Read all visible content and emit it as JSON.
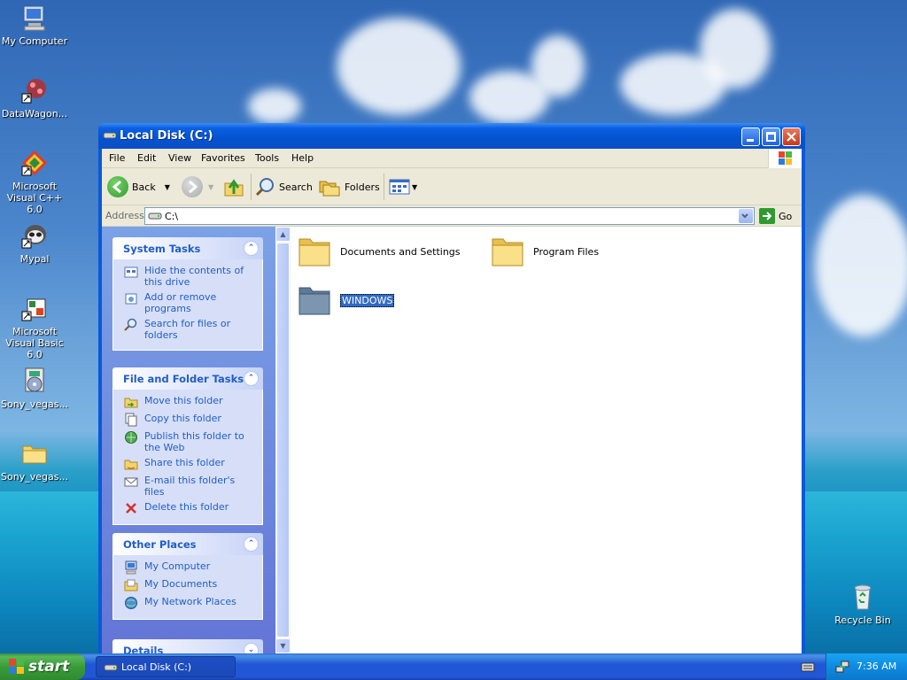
{
  "desktop": {
    "icons": [
      {
        "label": "My Computer",
        "icon": "my-computer-icon"
      },
      {
        "label": "DataWagon...",
        "icon": "datawagon-shortcut-icon"
      },
      {
        "label": "Microsoft Visual C++ 6.0",
        "icon": "visual-cpp-shortcut-icon"
      },
      {
        "label": "Mypal",
        "icon": "mypal-shortcut-icon"
      },
      {
        "label": "Microsoft Visual Basic 6.0",
        "icon": "visual-basic-shortcut-icon"
      },
      {
        "label": "Sony_vegas...",
        "icon": "sony-vegas-installer-icon"
      },
      {
        "label": "Sony_vegas...",
        "icon": "folder-icon"
      },
      {
        "label": "Recycle Bin",
        "icon": "recycle-bin-icon"
      }
    ]
  },
  "window": {
    "title": "Local Disk (C:)",
    "menu": [
      "File",
      "Edit",
      "View",
      "Favorites",
      "Tools",
      "Help"
    ],
    "toolbar": {
      "back": "Back",
      "search": "Search",
      "folders": "Folders"
    },
    "address": {
      "label": "Address",
      "value": "C:\\",
      "go": "Go"
    },
    "panels": {
      "system_tasks": {
        "title": "System Tasks",
        "items": [
          "Hide the contents of this drive",
          "Add or remove programs",
          "Search for files or folders"
        ]
      },
      "file_folder_tasks": {
        "title": "File and Folder Tasks",
        "items": [
          "Move this folder",
          "Copy this folder",
          "Publish this folder to the Web",
          "Share this folder",
          "E-mail this folder's files",
          "Delete this folder"
        ]
      },
      "other_places": {
        "title": "Other Places",
        "items": [
          "My Computer",
          "My Documents",
          "My Network Places"
        ]
      },
      "details": {
        "title": "Details"
      }
    },
    "folders": [
      {
        "name": "Documents and Settings",
        "selected": false
      },
      {
        "name": "Program Files",
        "selected": false
      },
      {
        "name": "WINDOWS",
        "selected": true
      }
    ]
  },
  "taskbar": {
    "start": "start",
    "task": "Local Disk (C:)",
    "clock": "7:36 AM"
  },
  "colors": {
    "title_bar": "#0453d0",
    "task_link": "#215dc6",
    "selection": "#316ac5",
    "start_green": "#3a9c3a"
  }
}
